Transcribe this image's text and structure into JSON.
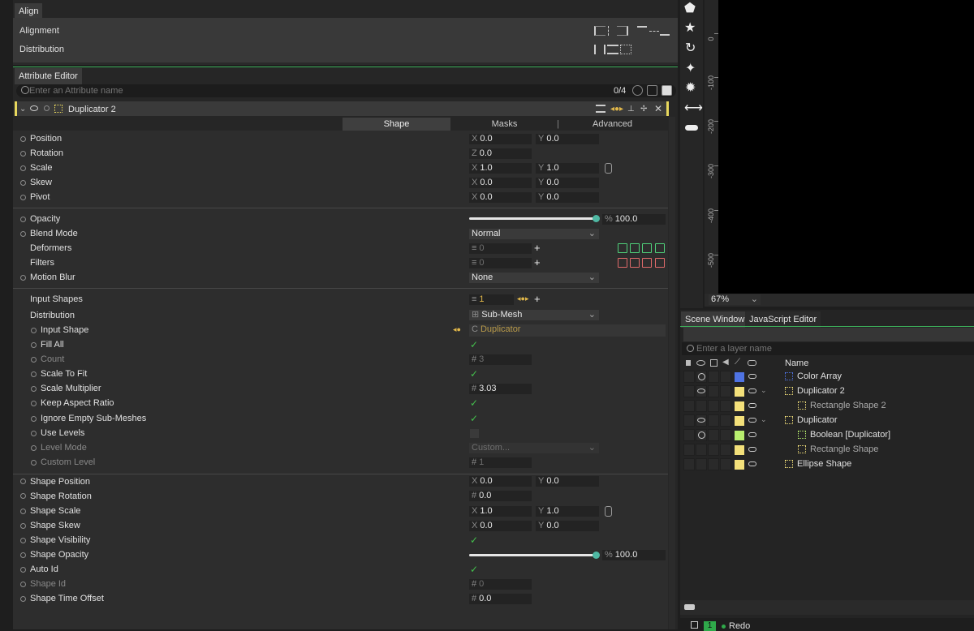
{
  "align": {
    "tab": "Align",
    "rows": [
      {
        "label": "Alignment"
      },
      {
        "label": "Distribution"
      }
    ]
  },
  "attr": {
    "tab": "Attribute Editor",
    "search_placeholder": "Enter an Attribute name",
    "count": "0/4",
    "object_name": "Duplicator 2",
    "subtabs": [
      "Shape",
      "Masks",
      "|",
      "Advanced"
    ],
    "rows": [
      {
        "label": "Position",
        "x": "0.0",
        "y": "0.0"
      },
      {
        "label": "Rotation",
        "z": "0.0"
      },
      {
        "label": "Scale",
        "x": "1.0",
        "y": "1.0"
      },
      {
        "label": "Skew",
        "x": "0.0",
        "y": "0.0"
      },
      {
        "label": "Pivot",
        "x": "0.0",
        "y": "0.0"
      },
      {
        "label": "Opacity",
        "pct": "100.0",
        "fill": 1.0
      },
      {
        "label": "Blend Mode",
        "value": "Normal"
      },
      {
        "label": "Deformers",
        "count": "0"
      },
      {
        "label": "Filters",
        "count": "0"
      },
      {
        "label": "Motion Blur",
        "value": "None"
      },
      {
        "label": "Input Shapes",
        "count": "1"
      },
      {
        "label": "Distribution",
        "value": "Sub-Mesh"
      },
      {
        "label": "Input Shape",
        "value": "Duplicator"
      },
      {
        "label": "Fill All"
      },
      {
        "label": "Count",
        "value": "3"
      },
      {
        "label": "Scale To Fit"
      },
      {
        "label": "Scale Multiplier",
        "value": "3.03"
      },
      {
        "label": "Keep Aspect Ratio"
      },
      {
        "label": "Ignore Empty Sub-Meshes"
      },
      {
        "label": "Use Levels"
      },
      {
        "label": "Level Mode",
        "value": "Custom..."
      },
      {
        "label": "Custom Level",
        "value": "1"
      },
      {
        "label": "Shape Position",
        "x": "0.0",
        "y": "0.0"
      },
      {
        "label": "Shape Rotation",
        "value": "0.0"
      },
      {
        "label": "Shape Scale",
        "x": "1.0",
        "y": "1.0"
      },
      {
        "label": "Shape Skew",
        "x": "0.0",
        "y": "0.0"
      },
      {
        "label": "Shape Visibility"
      },
      {
        "label": "Shape Opacity",
        "pct": "100.0",
        "fill": 1.0
      },
      {
        "label": "Auto Id"
      },
      {
        "label": "Shape Id",
        "value": "0"
      },
      {
        "label": "Shape Time Offset",
        "value": "0.0"
      }
    ]
  },
  "viewport": {
    "ruler": [
      "0",
      "-100",
      "-200",
      "-300",
      "-400",
      "-500"
    ],
    "zoom": "67%"
  },
  "scene": {
    "tabs": [
      "Scene Window",
      "JavaScript Editor"
    ],
    "search_placeholder": "Enter a layer name",
    "col_name": "Name",
    "layers": [
      {
        "name": "Color Array",
        "color": "#4f73e3"
      },
      {
        "name": "Duplicator 2",
        "color": "#f3e07a"
      },
      {
        "name": "Rectangle Shape 2",
        "color": "#f3e07a"
      },
      {
        "name": "Duplicator",
        "color": "#f3e07a"
      },
      {
        "name": "Boolean [Duplicator]",
        "color": "#b7ee6e"
      },
      {
        "name": "Rectangle Shape",
        "color": "#f3e07a"
      },
      {
        "name": "Ellipse Shape",
        "color": "#f3e07a"
      }
    ],
    "history_count": "1",
    "history_label": "Redo"
  },
  "ruler_axes": {
    "x": "X",
    "y": "Y",
    "z": "Z",
    "hash": "#",
    "pct": "%",
    "c": "C"
  }
}
